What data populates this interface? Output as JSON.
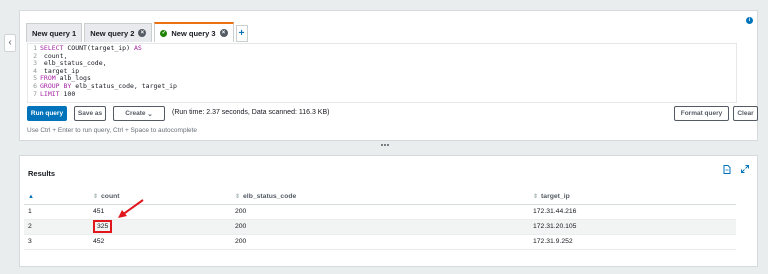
{
  "tabs": [
    {
      "label": "New query 1",
      "active": false,
      "closable": false
    },
    {
      "label": "New query 2",
      "active": false,
      "closable": true
    },
    {
      "label": "New query 3",
      "active": true,
      "closable": true,
      "status": "success"
    }
  ],
  "tab_add_label": "+",
  "info_icon": "i",
  "left_toggle_icon": "‹",
  "editor": {
    "lines": [
      {
        "n": "1",
        "parts": [
          {
            "t": "SELECT",
            "k": true
          },
          {
            "t": " COUNT(target_ip) ",
            "k": false
          },
          {
            "t": "AS",
            "k": true
          }
        ]
      },
      {
        "n": "2",
        "parts": [
          {
            "t": " count,",
            "k": false
          }
        ]
      },
      {
        "n": "3",
        "parts": [
          {
            "t": " elb_status_code,",
            "k": false
          }
        ]
      },
      {
        "n": "4",
        "parts": [
          {
            "t": " target_ip",
            "k": false
          }
        ]
      },
      {
        "n": "5",
        "parts": [
          {
            "t": "FROM",
            "k": true
          },
          {
            "t": " alb_logs",
            "k": false
          }
        ]
      },
      {
        "n": "6",
        "parts": [
          {
            "t": "GROUP BY",
            "k": true
          },
          {
            "t": " elb_status_code, target_ip",
            "k": false
          }
        ]
      },
      {
        "n": "7",
        "parts": [
          {
            "t": "LIMIT",
            "k": true
          },
          {
            "t": " 100",
            "k": false
          }
        ]
      }
    ]
  },
  "toolbar": {
    "run_label": "Run query",
    "save_as_label": "Save as",
    "create_label": "Create",
    "create_chevron": "⌄",
    "runtime_text": "(Run time: 2.37 seconds, Data scanned: 116.3 KB)",
    "format_label": "Format query",
    "clear_label": "Clear"
  },
  "hint_text": "Use Ctrl + Enter to run query, Ctrl + Space to autocomplete",
  "results": {
    "title": "Results",
    "columns": [
      "",
      "count",
      "elb_status_code",
      "target_ip"
    ],
    "rows": [
      [
        "1",
        "451",
        "200",
        "172.31.44.216"
      ],
      [
        "2",
        "325",
        "200",
        "172.31.20.105"
      ],
      [
        "3",
        "452",
        "200",
        "172.31.9.252"
      ]
    ],
    "highlighted_cell": {
      "row": 2,
      "column": "count"
    }
  },
  "colors": {
    "accent": "#0073bb",
    "tab_active_border": "#ec7211",
    "highlight": "#e0161c",
    "success": "#1d8102"
  }
}
